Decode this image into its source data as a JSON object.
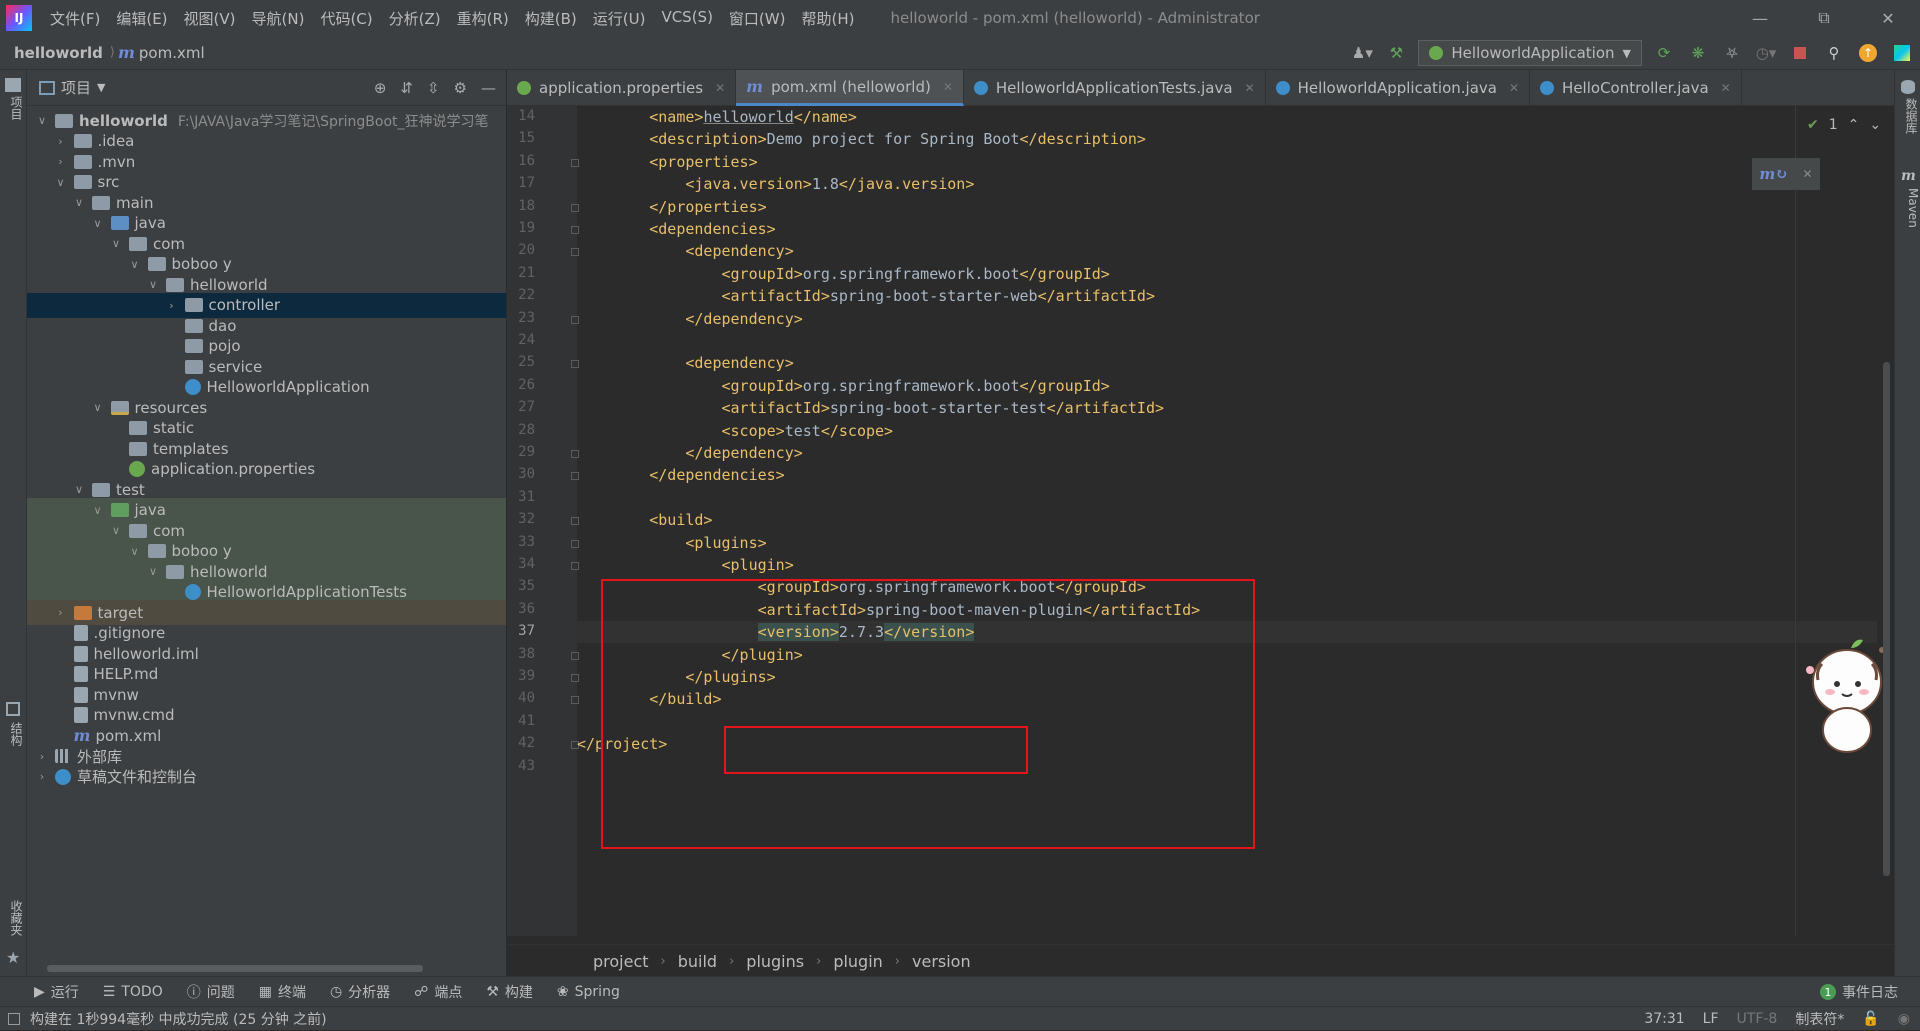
{
  "menubar": {
    "menus": [
      "文件(F)",
      "编辑(E)",
      "视图(V)",
      "导航(N)",
      "代码(C)",
      "分析(Z)",
      "重构(R)",
      "构建(B)",
      "运行(U)",
      "VCS(S)",
      "窗口(W)",
      "帮助(H)"
    ],
    "window_title": "helloworld - pom.xml (helloworld) - Administrator"
  },
  "navbar": {
    "project": "helloworld",
    "file": "pom.xml",
    "run_config": "HelloworldApplication"
  },
  "left_strip": {
    "project_tab": "项目",
    "structure_tab": "结构",
    "favorites_tab": "收藏夹"
  },
  "right_strip": {
    "database_tab": "数据库",
    "maven_tab": "Maven"
  },
  "project_panel": {
    "title": "项目",
    "root_path": "F:\\JAVA\\Java学习笔记\\SpringBoot_狂神说学习笔"
  },
  "tree": [
    {
      "label": "helloworld",
      "depth": 0,
      "arrow": "v",
      "icon": "folder-module",
      "bold": true
    },
    {
      "label": ".idea",
      "depth": 1,
      "arrow": ">",
      "icon": "folder"
    },
    {
      "label": ".mvn",
      "depth": 1,
      "arrow": ">",
      "icon": "folder"
    },
    {
      "label": "src",
      "depth": 1,
      "arrow": "v",
      "icon": "folder"
    },
    {
      "label": "main",
      "depth": 2,
      "arrow": "v",
      "icon": "folder"
    },
    {
      "label": "java",
      "depth": 3,
      "arrow": "v",
      "icon": "folder-blue"
    },
    {
      "label": "com",
      "depth": 4,
      "arrow": "v",
      "icon": "folder"
    },
    {
      "label": "boboo y",
      "depth": 5,
      "arrow": "v",
      "icon": "folder"
    },
    {
      "label": "helloworld",
      "depth": 6,
      "arrow": "v",
      "icon": "folder"
    },
    {
      "label": "controller",
      "depth": 7,
      "arrow": ">",
      "icon": "folder",
      "state": "selected"
    },
    {
      "label": "dao",
      "depth": 7,
      "arrow": "",
      "icon": "folder"
    },
    {
      "label": "pojo",
      "depth": 7,
      "arrow": "",
      "icon": "folder"
    },
    {
      "label": "service",
      "depth": 7,
      "arrow": "",
      "icon": "folder"
    },
    {
      "label": "HelloworldApplication",
      "depth": 7,
      "arrow": "",
      "icon": "spring-class"
    },
    {
      "label": "resources",
      "depth": 3,
      "arrow": "v",
      "icon": "folder-res"
    },
    {
      "label": "static",
      "depth": 4,
      "arrow": "",
      "icon": "folder"
    },
    {
      "label": "templates",
      "depth": 4,
      "arrow": "",
      "icon": "folder"
    },
    {
      "label": "application.properties",
      "depth": 4,
      "arrow": "",
      "icon": "spring"
    },
    {
      "label": "test",
      "depth": 2,
      "arrow": "v",
      "icon": "folder"
    },
    {
      "label": "java",
      "depth": 3,
      "arrow": "v",
      "icon": "folder-green",
      "state": "green"
    },
    {
      "label": "com",
      "depth": 4,
      "arrow": "v",
      "icon": "folder",
      "state": "green"
    },
    {
      "label": "boboo y",
      "depth": 5,
      "arrow": "v",
      "icon": "folder",
      "state": "green"
    },
    {
      "label": "helloworld",
      "depth": 6,
      "arrow": "v",
      "icon": "folder",
      "state": "green"
    },
    {
      "label": "HelloworldApplicationTests",
      "depth": 7,
      "arrow": "",
      "icon": "class",
      "state": "green"
    },
    {
      "label": "target",
      "depth": 1,
      "arrow": ">",
      "icon": "folder-orange",
      "state": "orange"
    },
    {
      "label": ".gitignore",
      "depth": 1,
      "arrow": "",
      "icon": "file"
    },
    {
      "label": "helloworld.iml",
      "depth": 1,
      "arrow": "",
      "icon": "file"
    },
    {
      "label": "HELP.md",
      "depth": 1,
      "arrow": "",
      "icon": "file"
    },
    {
      "label": "mvnw",
      "depth": 1,
      "arrow": "",
      "icon": "file"
    },
    {
      "label": "mvnw.cmd",
      "depth": 1,
      "arrow": "",
      "icon": "file"
    },
    {
      "label": "pom.xml",
      "depth": 1,
      "arrow": "",
      "icon": "maven"
    },
    {
      "label": "外部库",
      "depth": 0,
      "arrow": ">",
      "icon": "lib"
    },
    {
      "label": "草稿文件和控制台",
      "depth": 0,
      "arrow": ">",
      "icon": "scratch"
    }
  ],
  "tabs": [
    {
      "label": "application.properties",
      "icon": "spring",
      "active": false
    },
    {
      "label": "pom.xml (helloworld)",
      "icon": "maven",
      "active": true
    },
    {
      "label": "HelloworldApplicationTests.java",
      "icon": "class",
      "active": false
    },
    {
      "label": "HelloworldApplication.java",
      "icon": "class",
      "active": false
    },
    {
      "label": "HelloController.java",
      "icon": "class",
      "active": false
    }
  ],
  "code_lines": [
    {
      "n": "14",
      "indent": "        ",
      "parts": [
        [
          "t",
          "<name>"
        ],
        [
          "u",
          "helloworld"
        ],
        [
          "t",
          "</name>"
        ]
      ]
    },
    {
      "n": "15",
      "indent": "        ",
      "parts": [
        [
          "t",
          "<description>"
        ],
        [
          "x",
          "Demo project for Spring Boot"
        ],
        [
          "t",
          "</description>"
        ]
      ]
    },
    {
      "n": "16",
      "indent": "        ",
      "parts": [
        [
          "t",
          "<properties>"
        ]
      ]
    },
    {
      "n": "17",
      "indent": "            ",
      "parts": [
        [
          "t",
          "<java.version>"
        ],
        [
          "x",
          "1.8"
        ],
        [
          "t",
          "</java.version>"
        ]
      ]
    },
    {
      "n": "18",
      "indent": "        ",
      "parts": [
        [
          "t",
          "</properties>"
        ]
      ]
    },
    {
      "n": "19",
      "indent": "        ",
      "parts": [
        [
          "t",
          "<dependencies>"
        ]
      ]
    },
    {
      "n": "20",
      "indent": "            ",
      "parts": [
        [
          "t",
          "<dependency>"
        ]
      ]
    },
    {
      "n": "21",
      "indent": "                ",
      "parts": [
        [
          "t",
          "<groupId>"
        ],
        [
          "x",
          "org.springframework.boot"
        ],
        [
          "t",
          "</groupId>"
        ]
      ]
    },
    {
      "n": "22",
      "indent": "                ",
      "parts": [
        [
          "t",
          "<artifactId>"
        ],
        [
          "x",
          "spring-boot-starter-web"
        ],
        [
          "t",
          "</artifactId>"
        ]
      ]
    },
    {
      "n": "23",
      "indent": "            ",
      "parts": [
        [
          "t",
          "</dependency>"
        ]
      ]
    },
    {
      "n": "24",
      "indent": "",
      "parts": []
    },
    {
      "n": "25",
      "indent": "            ",
      "parts": [
        [
          "t",
          "<dependency>"
        ]
      ]
    },
    {
      "n": "26",
      "indent": "                ",
      "parts": [
        [
          "t",
          "<groupId>"
        ],
        [
          "x",
          "org.springframework.boot"
        ],
        [
          "t",
          "</groupId>"
        ]
      ]
    },
    {
      "n": "27",
      "indent": "                ",
      "parts": [
        [
          "t",
          "<artifactId>"
        ],
        [
          "x",
          "spring-boot-starter-test"
        ],
        [
          "t",
          "</artifactId>"
        ]
      ]
    },
    {
      "n": "28",
      "indent": "                ",
      "parts": [
        [
          "t",
          "<scope>"
        ],
        [
          "x",
          "test"
        ],
        [
          "t",
          "</scope>"
        ]
      ]
    },
    {
      "n": "29",
      "indent": "            ",
      "parts": [
        [
          "t",
          "</dependency>"
        ]
      ]
    },
    {
      "n": "30",
      "indent": "        ",
      "parts": [
        [
          "t",
          "</dependencies>"
        ]
      ]
    },
    {
      "n": "31",
      "indent": "",
      "parts": []
    },
    {
      "n": "32",
      "indent": "        ",
      "parts": [
        [
          "t",
          "<build>"
        ]
      ]
    },
    {
      "n": "33",
      "indent": "            ",
      "parts": [
        [
          "t",
          "<plugins>"
        ]
      ]
    },
    {
      "n": "34",
      "indent": "                ",
      "parts": [
        [
          "t",
          "<plugin>"
        ]
      ]
    },
    {
      "n": "35",
      "indent": "                    ",
      "parts": [
        [
          "t",
          "<groupId>"
        ],
        [
          "x",
          "org.springframework.boot"
        ],
        [
          "t",
          "</groupId>"
        ]
      ]
    },
    {
      "n": "36",
      "indent": "                    ",
      "parts": [
        [
          "t",
          "<artifactId>"
        ],
        [
          "x",
          "spring-boot-maven-plugin"
        ],
        [
          "t",
          "</artifactId>"
        ]
      ]
    },
    {
      "n": "37",
      "indent": "                    ",
      "parts": [
        [
          "h",
          "<version>"
        ],
        [
          "x",
          "2.7.3"
        ],
        [
          "h",
          "</version>"
        ]
      ],
      "current": true
    },
    {
      "n": "38",
      "indent": "                ",
      "parts": [
        [
          "t",
          "</plugin>"
        ]
      ]
    },
    {
      "n": "39",
      "indent": "            ",
      "parts": [
        [
          "t",
          "</plugins>"
        ]
      ]
    },
    {
      "n": "40",
      "indent": "        ",
      "parts": [
        [
          "t",
          "</build>"
        ]
      ]
    },
    {
      "n": "41",
      "indent": "",
      "parts": []
    },
    {
      "n": "42",
      "indent": "",
      "parts": [
        [
          "t",
          "</project>"
        ]
      ]
    },
    {
      "n": "43",
      "indent": "",
      "parts": []
    }
  ],
  "inspection": {
    "count": "1"
  },
  "breadcrumb": [
    "project",
    "build",
    "plugins",
    "plugin",
    "version"
  ],
  "bottom_tools": [
    "运行",
    "TODO",
    "问题",
    "终端",
    "分析器",
    "端点",
    "构建",
    "Spring"
  ],
  "event_log": {
    "label": "事件日志",
    "count": "1"
  },
  "status": {
    "message": "构建在 1秒994毫秒 中成功完成 (25 分钟 之前)",
    "position": "37:31",
    "line_sep": "LF",
    "encoding": "UTF-8",
    "indent": "制表符*"
  }
}
